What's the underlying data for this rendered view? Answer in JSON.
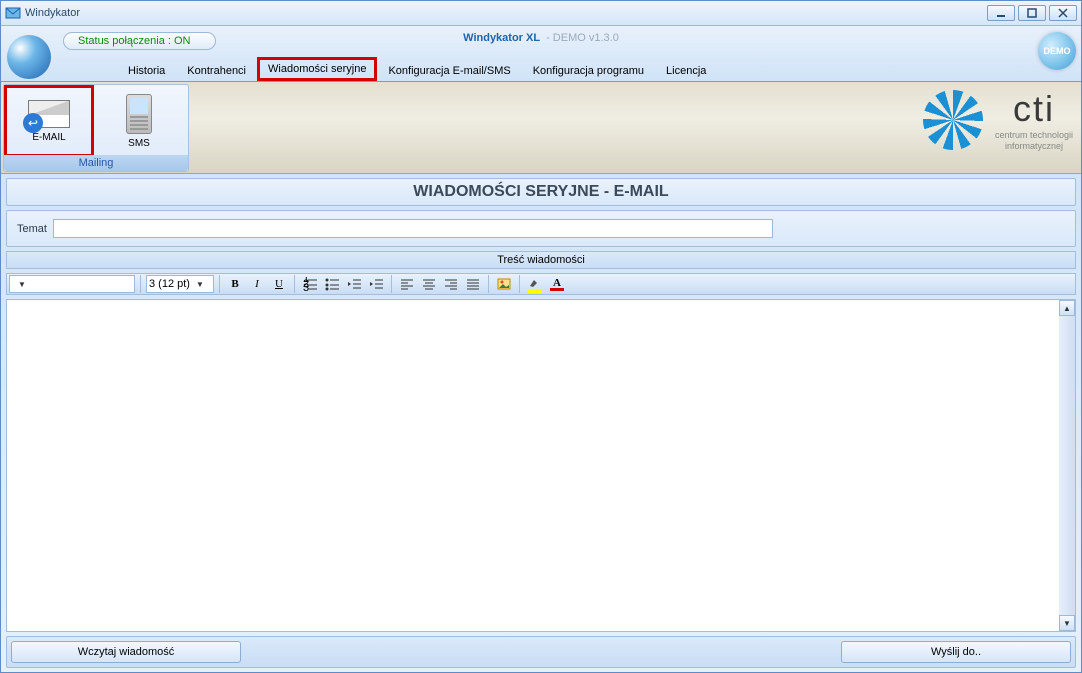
{
  "window": {
    "title": "Windykator"
  },
  "status": {
    "text": "Status połączenia : ON"
  },
  "app": {
    "name": "Windykator XL",
    "version": "- DEMO v1.3.0",
    "demo_badge": "DEMO"
  },
  "tabs": {
    "historia": "Historia",
    "kontrahenci": "Kontrahenci",
    "wiadomosci": "Wiadomości seryjne",
    "konfig_email": "Konfiguracja E-mail/SMS",
    "konfig_prog": "Konfiguracja programu",
    "licencja": "Licencja"
  },
  "ribbon": {
    "group_label": "Mailing",
    "email": "E-MAIL",
    "sms": "SMS"
  },
  "brand": {
    "name": "cti",
    "sub1": "centrum technologii",
    "sub2": "informatycznej"
  },
  "page": {
    "title": "WIADOMOŚCI SERYJNE - E-MAIL",
    "temat_label": "Temat",
    "temat_value": "",
    "tresc_label": "Treść wiadomości"
  },
  "toolbar": {
    "font_family": "",
    "font_size": "3 (12 pt)",
    "bold": "B",
    "italic": "I",
    "underline": "U",
    "highlight_letter": "A",
    "color_letter": "A"
  },
  "buttons": {
    "load": "Wczytaj wiadomość",
    "send": "Wyślij do.."
  }
}
